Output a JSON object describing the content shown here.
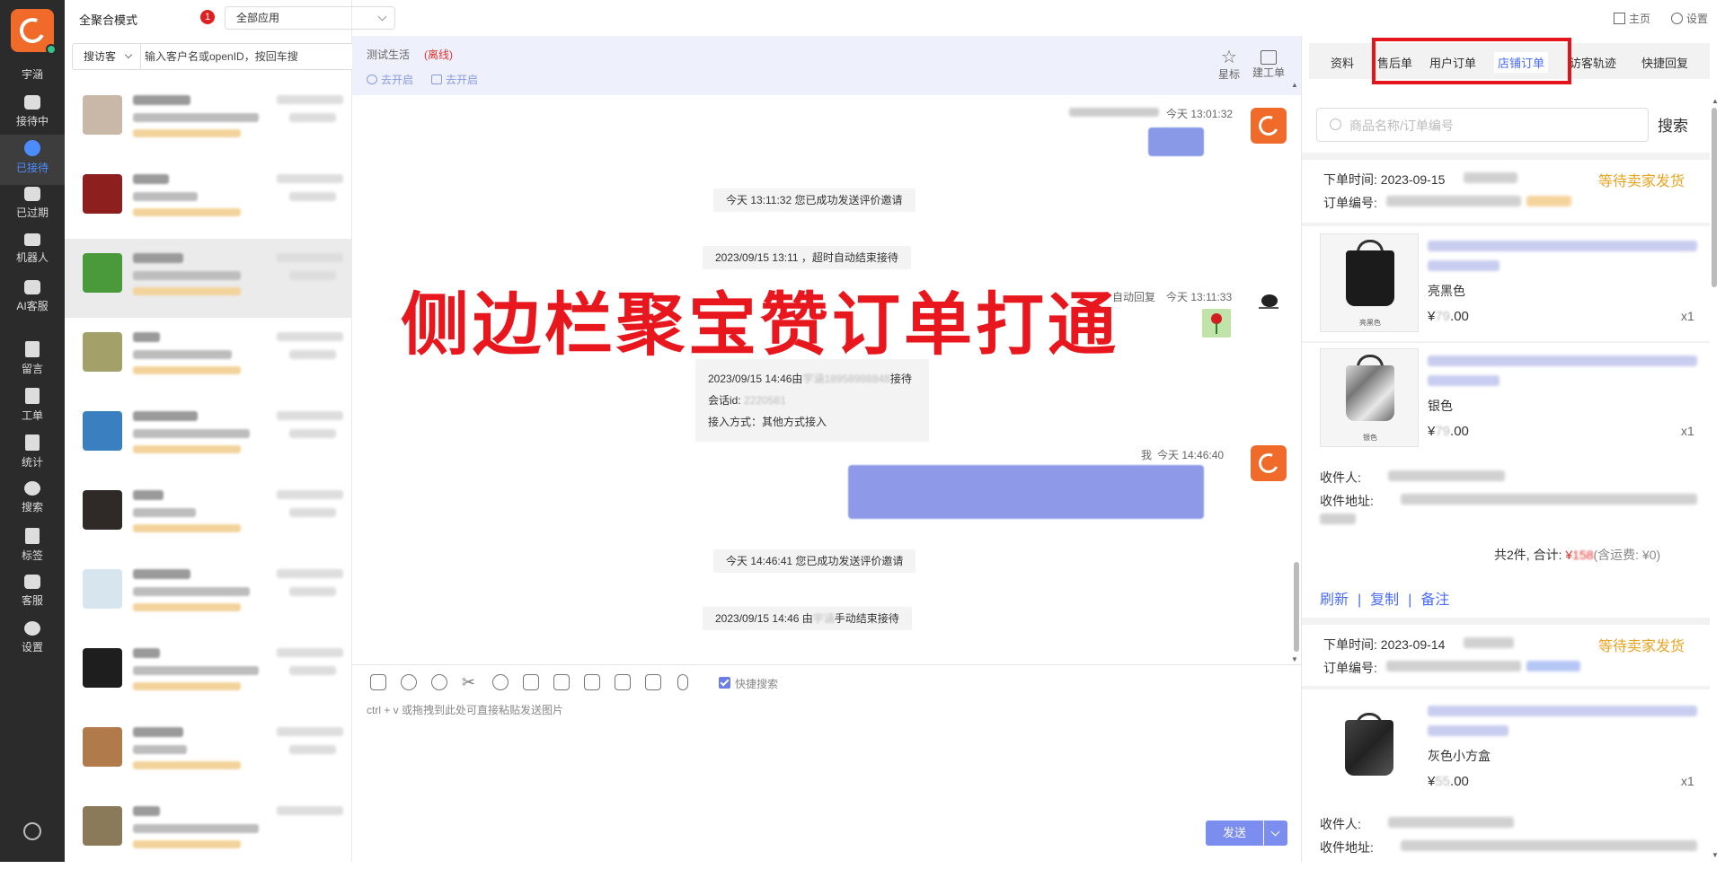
{
  "nav": {
    "brand": "宇涵",
    "items": [
      {
        "label": "接待中"
      },
      {
        "label": "已接待"
      },
      {
        "label": "已过期"
      },
      {
        "label": "机器人"
      },
      {
        "label": "AI客服"
      },
      {
        "label": "留言"
      },
      {
        "label": "工单"
      },
      {
        "label": "统计"
      },
      {
        "label": "搜索"
      },
      {
        "label": "标签"
      },
      {
        "label": "客服"
      },
      {
        "label": "设置"
      }
    ]
  },
  "list": {
    "mode_label": "全聚合模式",
    "mode_badge": "1",
    "app_select": "全部应用",
    "search_type": "搜访客",
    "search_placeholder": "输入客户名或openID，按回车搜"
  },
  "chat": {
    "visitor_name": "测试生活",
    "status": "(离线)",
    "link_1": "去开启",
    "link_2": "去开启",
    "tool_star": "星标",
    "tool_ticket": "建工单",
    "msg1_time": "今天 13:01:32",
    "sys1": "今天 13:11:32 您已成功发送评价邀请",
    "sys2": "2023/09/15 13:11 ，超时自动结束接待",
    "auto_reply": "自动回复",
    "msg2_time": "今天 13:11:33",
    "card_line1_a": "2023/09/15 14:46由",
    "card_line1_b": "接待",
    "card_line2": "会话id:",
    "card_line3": "接入方式：其他方式接入",
    "me_label": "我",
    "msg3_time": "今天 14:46:40",
    "sys3": "今天 14:46:41 您已成功发送评价邀请",
    "sys4_a": "2023/09/15 14:46 由",
    "sys4_b": "手动结束接待",
    "quick_search": "快捷搜索",
    "input_hint": "ctrl + v 或拖拽到此处可直接粘贴发送图片",
    "send": "发送"
  },
  "overlay_caption": "侧边栏聚宝赞订单打通",
  "topbar": {
    "home": "主页",
    "settings": "设置"
  },
  "panel": {
    "tabs": [
      {
        "label": "资料"
      },
      {
        "label": "售后单"
      },
      {
        "label": "用户订单"
      },
      {
        "label": "店铺订单",
        "active": true
      },
      {
        "label": "访客轨迹"
      },
      {
        "label": "快捷回复"
      }
    ],
    "search_placeholder": "商品名称/订单编号",
    "search_btn": "搜索",
    "order1": {
      "time_label": "下单时间: 2023-09-15",
      "status": "等待卖家发货",
      "no_label": "订单编号:",
      "items": [
        {
          "variant": "亮黑色",
          "caption": "亮黑色",
          "price_a": "¥",
          "price_b": ".00",
          "qty": "x1"
        },
        {
          "variant": "银色",
          "caption": "银色",
          "price_a": "¥",
          "price_b": ".00",
          "qty": "x1"
        }
      ],
      "receiver_label": "收件人:",
      "address_label": "收件地址:",
      "total_a": "共2件, 合计: ",
      "total_cur": "¥",
      "total_b": "(含运费: ¥0)",
      "action_refresh": "刷新",
      "action_copy": "复制",
      "action_note": "备注",
      "sep": "|"
    },
    "order2": {
      "time_label": "下单时间: 2023-09-14",
      "status": "等待卖家发货",
      "no_label": "订单编号:",
      "item": {
        "variant": "灰色小方盒",
        "price_a": "¥",
        "price_b": ".00",
        "qty": "x1"
      },
      "receiver_label": "收件人:",
      "address_label": "收件地址:"
    }
  },
  "colors": {
    "accent": "#4a6cf7",
    "brand_orange": "#f06a2a",
    "overlay_red": "#e8161d",
    "status_orange": "#e8a423"
  }
}
